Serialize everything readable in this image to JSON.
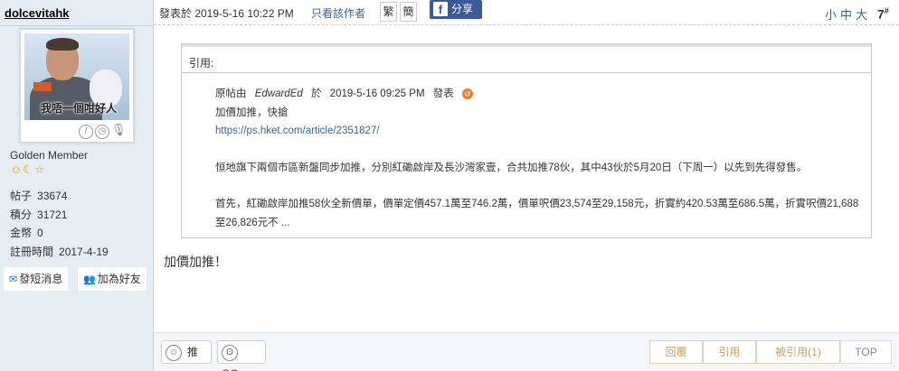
{
  "user": {
    "name": "dolcevitahk",
    "avatar_caption": "我唔一個咁好人",
    "rank": "Golden Member",
    "medals": "☺☾☆",
    "stats": [
      {
        "label": "帖子",
        "value": "33674"
      },
      {
        "label": "積分",
        "value": "31721"
      },
      {
        "label": "金幣",
        "value": "0"
      },
      {
        "label": "註冊時間",
        "value": "2017-4-19"
      }
    ],
    "pm_label": "發短消息",
    "friend_label": "加為好友"
  },
  "header": {
    "posted_at": "發表於 2019-5-16 10:22 PM",
    "author_only": "只看該作者",
    "lang_trad": "繁",
    "lang_simp": "簡",
    "share_label": "分享",
    "font_small": "小",
    "font_mid": "中",
    "font_large": "大",
    "floor_num": "7",
    "floor_sup": "#"
  },
  "quote": {
    "label": "引用:",
    "origin_prefix": "原帖由",
    "origin_author": "EdwardEd",
    "origin_at": "於",
    "origin_time": "2019-5-16  09:25  PM",
    "origin_suffix": "發表",
    "line1": "加價加推，快搶",
    "link": "https://ps.hket.com/article/2351827/",
    "para1": "恒地旗下兩個市區新盤同步加推，分別紅磡啟岸及長沙灣家壹，合共加推78伙，其中43伙於5月20日（下周一）以先到先得發售。",
    "para2": "首先，紅磡啟岸加推58伙全新價單，價單定價457.1萬至746.2萬，價單呎價23,574至29,158元，折實約420.53萬至686.5萬，折實呎價21,688至26,826元不   ..."
  },
  "post_text": "加價加推！",
  "footer": {
    "like_label": "推",
    "gg_label": "GG",
    "reply_label": "回覆",
    "quote_label": "引用",
    "reported_label": "被引用(1)",
    "top_label": "TOP"
  }
}
